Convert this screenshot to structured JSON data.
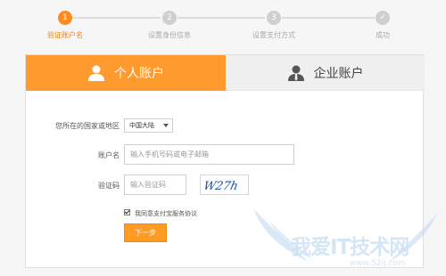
{
  "progress": {
    "steps": [
      {
        "num": "1",
        "label": "验证账户名",
        "active": true
      },
      {
        "num": "2",
        "label": "设置身份信息",
        "active": false
      },
      {
        "num": "3",
        "label": "设置支付方式",
        "active": false
      },
      {
        "num": "✓",
        "label": "成功",
        "active": false
      }
    ]
  },
  "tabs": {
    "personal": "个人账户",
    "enterprise": "企业账户"
  },
  "form": {
    "region_label": "您所在的国家或地区",
    "region_value": "中国大陆",
    "account_label": "账户名",
    "account_placeholder": "输入手机号码或电子邮箱",
    "captcha_label": "验证码",
    "captcha_placeholder": "输入验证码",
    "captcha_text": "W27h",
    "agree_text": "我同意支付宝服务协议",
    "agree_checked": true,
    "next_button": "下一步"
  },
  "watermark": {
    "title": "我爱IT技术网",
    "url": "www.52ij.com"
  },
  "colors": {
    "accent": "#ff9a2e",
    "active_step": "#ff8a1f",
    "inactive_step": "#cfcfcf"
  }
}
